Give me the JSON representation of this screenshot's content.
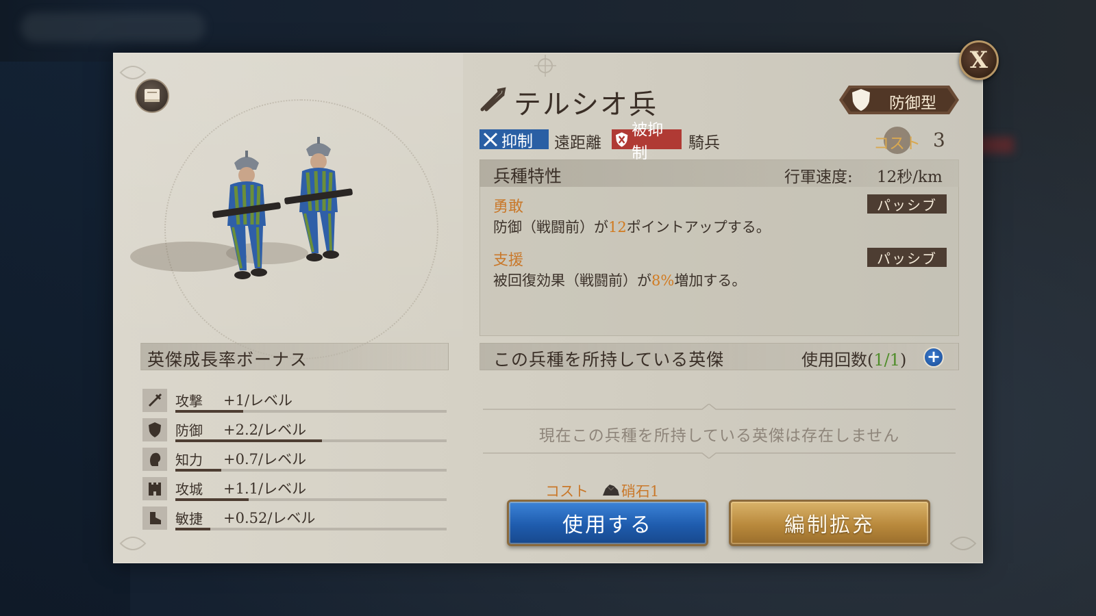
{
  "close": {
    "label": "X"
  },
  "unit": {
    "name": "テルシオ兵",
    "type_label": "防御型",
    "counters_label": "抑制",
    "counters_target": "遠距離",
    "countered_label": "被抑制",
    "countered_target": "騎兵",
    "cost_label": "コスト",
    "cost_value": "3"
  },
  "traits": {
    "title": "兵種特性",
    "speed_label": "行軍速度:",
    "speed_value": "12秒/km",
    "skills": [
      {
        "name": "勇敢",
        "badge": "パッシブ",
        "desc_pre": "防御（戦闘前）が",
        "desc_hl": "12",
        "desc_post": "ポイントアップする。"
      },
      {
        "name": "支援",
        "badge": "パッシブ",
        "desc_pre": "被回復効果（戦闘前）が",
        "desc_hl": "8%",
        "desc_post": "増加する。"
      }
    ]
  },
  "heroes": {
    "title": "この兵種を所持している英傑",
    "use_count_pre": "使用回数(",
    "use_count_num": "1/1",
    "use_count_post": ")",
    "empty_message": "現在この兵種を所持している英傑は存在しません"
  },
  "action": {
    "cost_label": "コスト",
    "cost_item": "硝石1",
    "use_button": "使用する",
    "expand_button": "編制拡充"
  },
  "growth": {
    "title": "英傑成長率ボーナス",
    "stats": [
      {
        "icon": "sword-icon",
        "name": "攻撃",
        "value": "+1/レベル",
        "level": 0.25
      },
      {
        "icon": "shield-icon",
        "name": "防御",
        "value": "+2.2/レベル",
        "level": 0.54
      },
      {
        "icon": "head-icon",
        "name": "知力",
        "value": "+0.7/レベル",
        "level": 0.17
      },
      {
        "icon": "castle-icon",
        "name": "攻城",
        "value": "+1.1/レベル",
        "level": 0.27
      },
      {
        "icon": "boot-icon",
        "name": "敏捷",
        "value": "+0.52/レベル",
        "level": 0.13
      }
    ]
  },
  "colors": {
    "counter_blue": "#2a5fa4",
    "countered_red": "#b03a34",
    "highlight_orange": "#d17a20",
    "use_button_blue": "#1f5cae",
    "expand_button_gold": "#b9893c"
  }
}
